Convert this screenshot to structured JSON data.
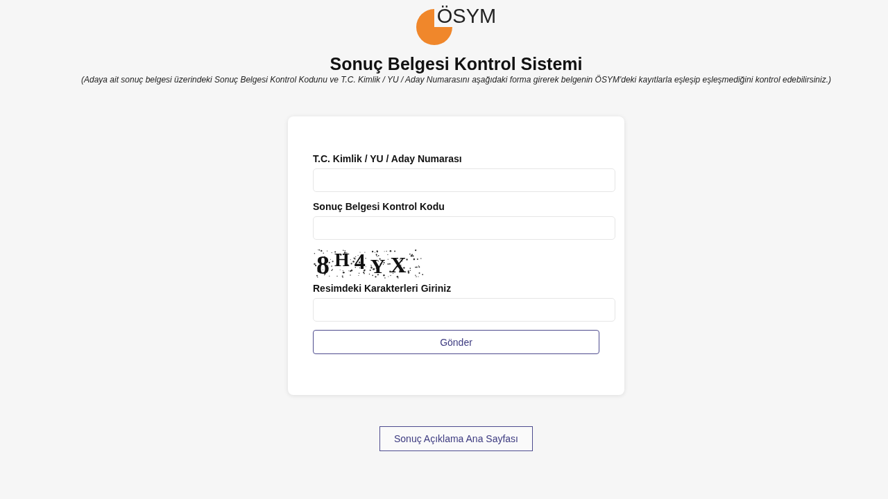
{
  "logo": {
    "text": "ÖSYM"
  },
  "title": "Sonuç Belgesi Kontrol Sistemi",
  "subtitle": "(Adaya ait sonuç belgesi üzerindeki Sonuç Belgesi Kontrol Kodunu ve T.C. Kimlik / YU / Aday Numarasını aşağıdaki forma girerek belgenin ÖSYM'deki kayıtlarla eşleşip eşleşmediğini kontrol edebilirsiniz.)",
  "form": {
    "fields": [
      {
        "kind": "text",
        "label": "T.C. Kimlik / YU / Aday Numarası"
      },
      {
        "kind": "text",
        "label": "Sonuç Belgesi Kontrol Kodu"
      },
      {
        "kind": "captcha",
        "captcha": "8H4YX",
        "label": "Resimdeki Karakterleri Giriniz"
      }
    ],
    "submit": "Gönder"
  },
  "home_link": "Sonuç Açıklama Ana Sayfası"
}
